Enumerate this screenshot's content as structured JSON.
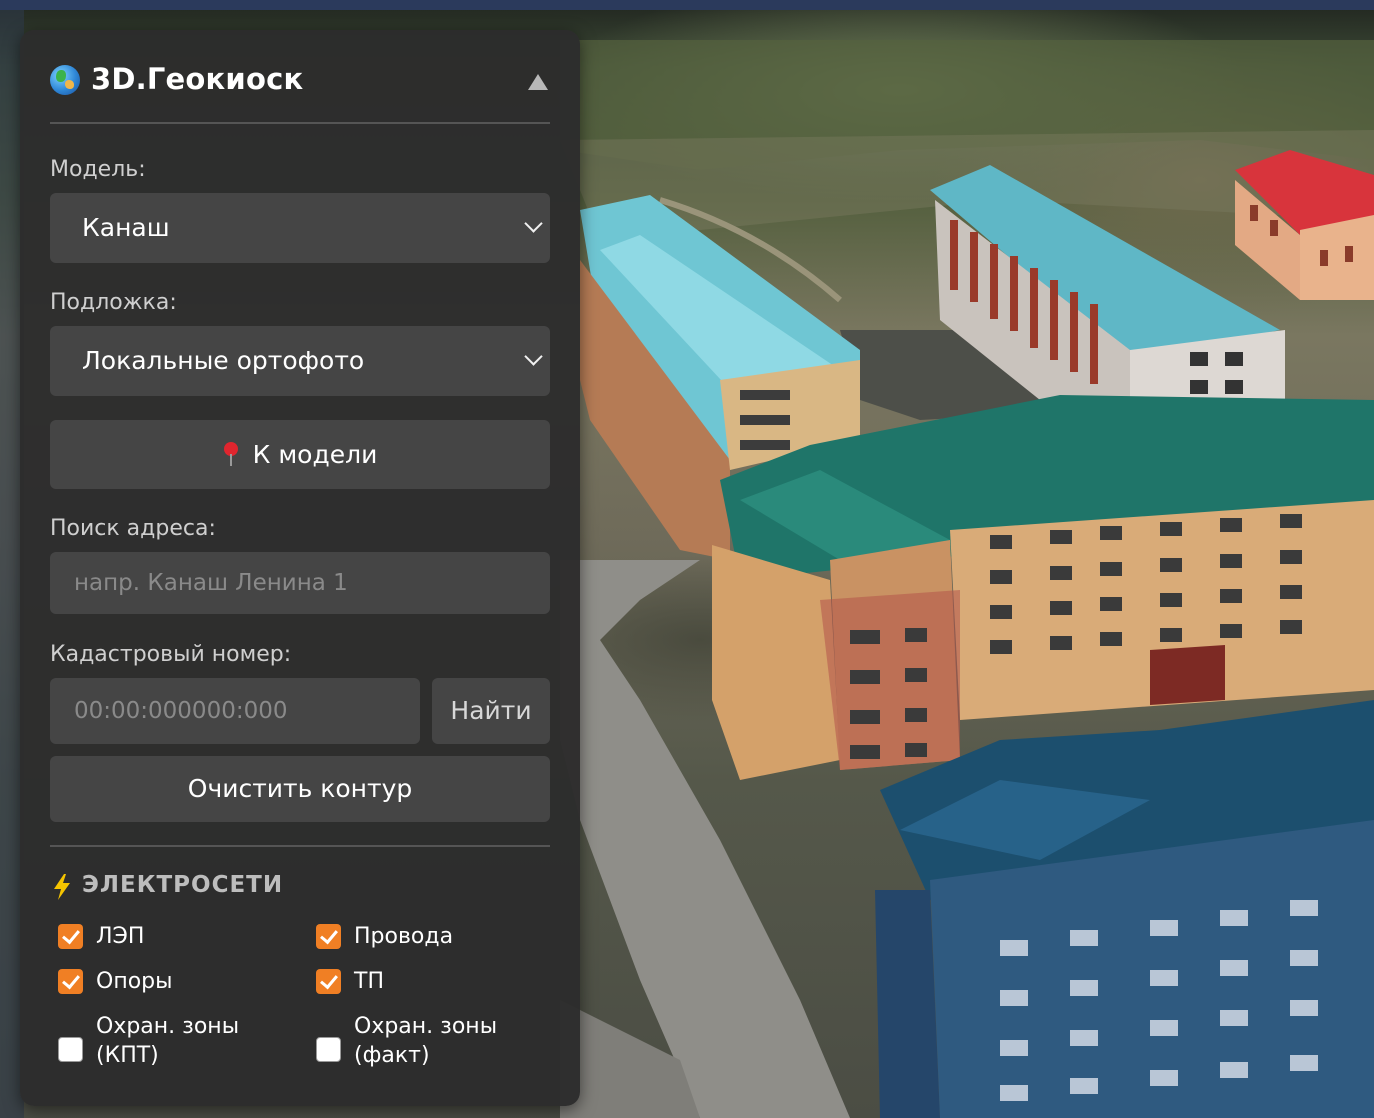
{
  "app": {
    "title": "3D.Геокиоск",
    "globe_icon": "globe-icon",
    "collapse_icon": "triangle-up-icon"
  },
  "model": {
    "label": "Модель:",
    "selected": "Канаш"
  },
  "basemap": {
    "label": "Подложка:",
    "selected": "Локальные ортофото"
  },
  "to_model_button": {
    "icon": "pin-icon",
    "label": "К модели"
  },
  "address": {
    "label": "Поиск адреса:",
    "placeholder": "напр. Канаш Ленина 1"
  },
  "cadastral": {
    "label": "Кадастровый номер:",
    "placeholder": "00:00:000000:000",
    "find_label": "Найти"
  },
  "clear_button": {
    "label": "Очистить контур"
  },
  "power": {
    "icon": "lightning-icon",
    "title": "ЭЛЕКТРОСЕТИ",
    "items": [
      {
        "label": "ЛЭП",
        "checked": true
      },
      {
        "label": "Провода",
        "checked": true
      },
      {
        "label": "Опоры",
        "checked": true
      },
      {
        "label": "ТП",
        "checked": true
      },
      {
        "label": "Охран. зоны (КПТ)",
        "checked": false
      },
      {
        "label": "Охран. зоны (факт)",
        "checked": false
      }
    ]
  },
  "colors": {
    "panel": "#2f2f2f",
    "control": "#454545",
    "accent": "#f07f24"
  }
}
